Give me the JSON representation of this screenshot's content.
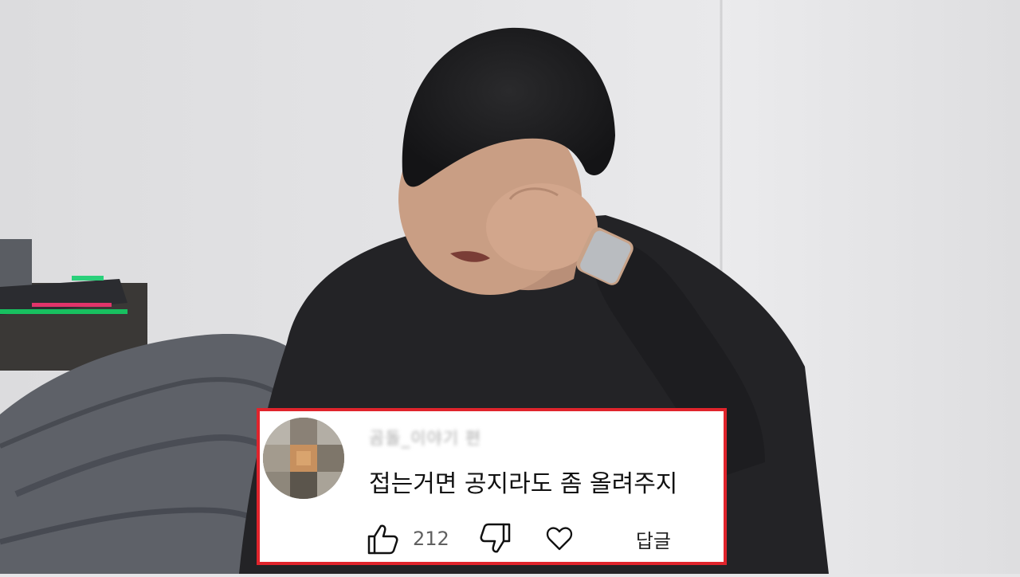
{
  "comment": {
    "username": "곰돌_이야기 편",
    "text": "접는거면 공지라도 좀 올려주지",
    "like_count": "212",
    "reply_label": "답글",
    "icons": {
      "like": "thumbs-up-icon",
      "dislike": "thumbs-down-icon",
      "heart": "heart-icon"
    },
    "border_color": "#e0242c"
  }
}
